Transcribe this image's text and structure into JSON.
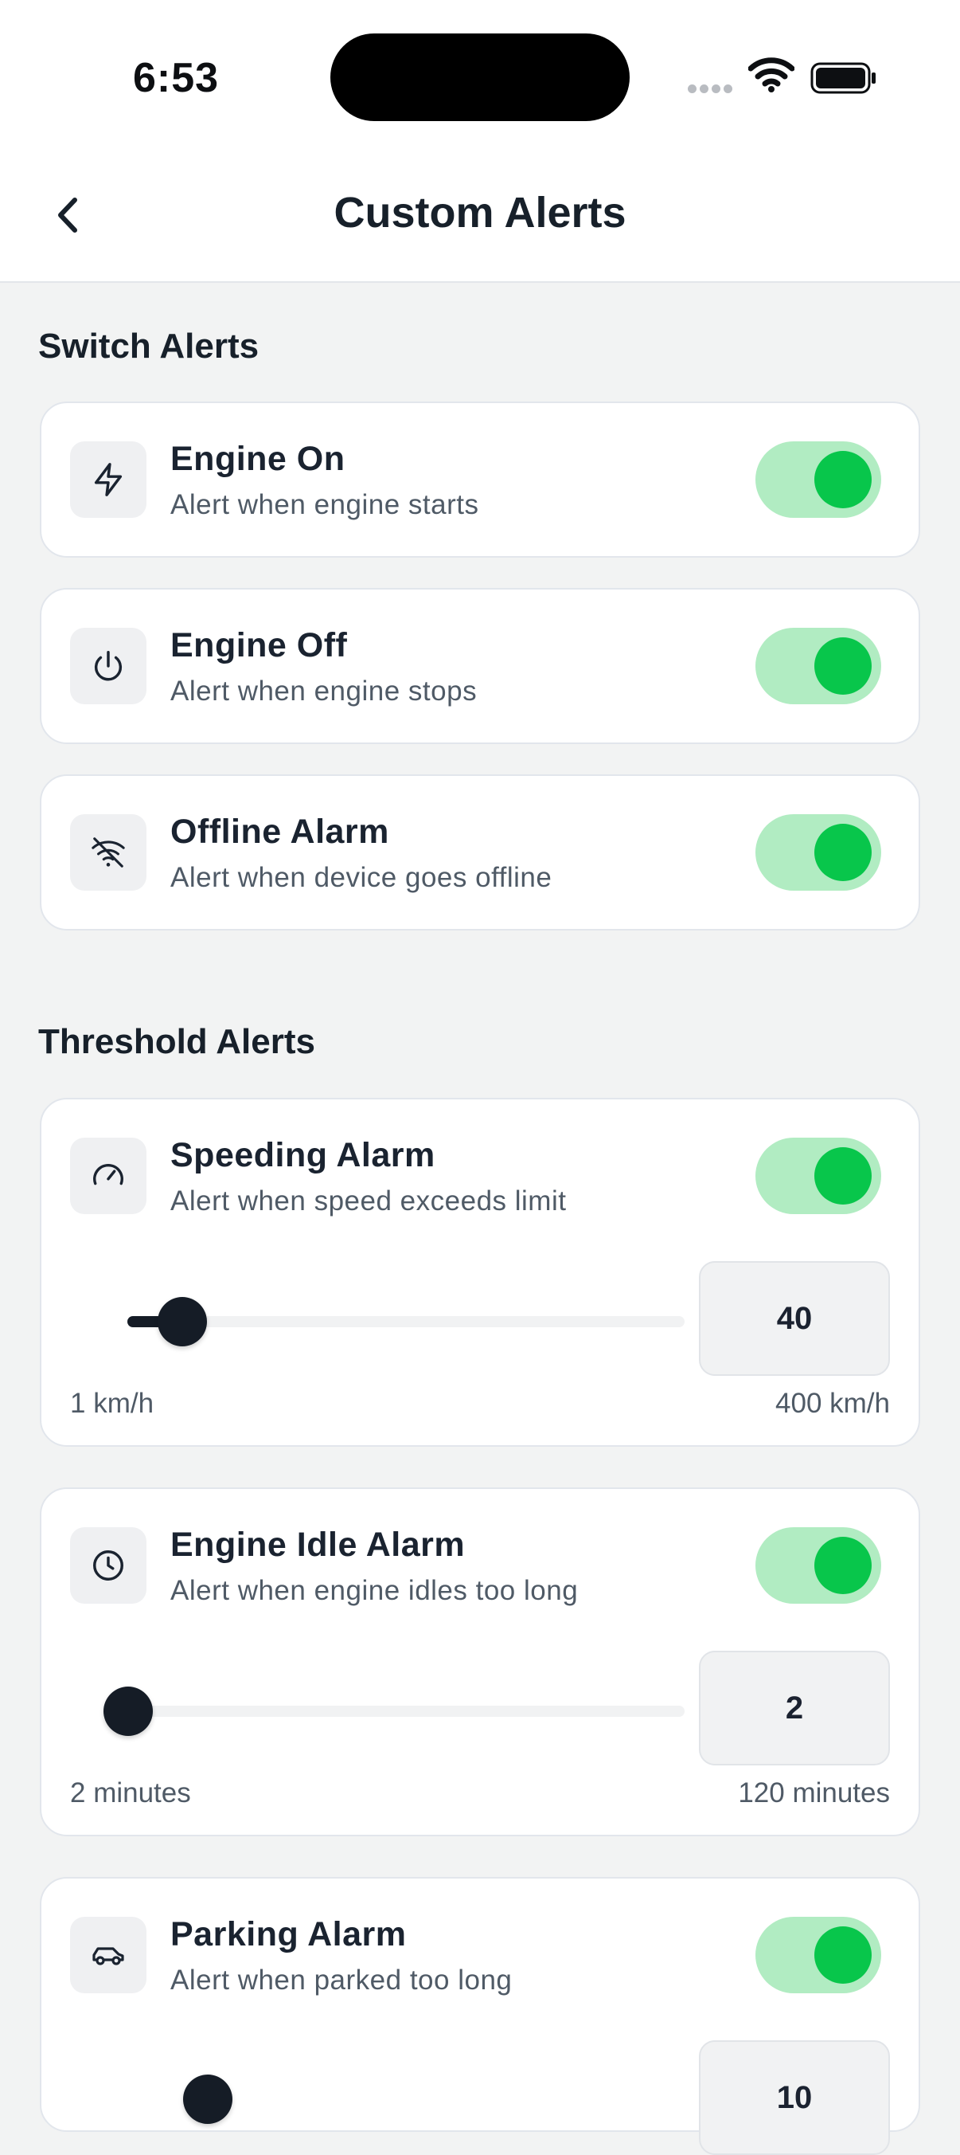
{
  "status_bar": {
    "time": "6:53"
  },
  "header": {
    "title": "Custom Alerts"
  },
  "switch_section": {
    "title": "Switch Alerts",
    "items": [
      {
        "name": "Engine On",
        "description": "Alert when engine starts",
        "icon": "lightning-icon",
        "enabled": true
      },
      {
        "name": "Engine Off",
        "description": "Alert when engine stops",
        "icon": "power-icon",
        "enabled": true
      },
      {
        "name": "Offline Alarm",
        "description": "Alert when device goes offline",
        "icon": "wifi-off-icon",
        "enabled": true
      }
    ]
  },
  "threshold_section": {
    "title": "Threshold Alerts",
    "items": [
      {
        "name": "Speeding Alarm",
        "description": "Alert when speed exceeds limit",
        "icon": "speedometer-icon",
        "enabled": true,
        "value": "40",
        "min_label": "1 km/h",
        "max_label": "400 km/h",
        "min": 1,
        "max": 400,
        "current": 40
      },
      {
        "name": "Engine Idle Alarm",
        "description": "Alert when engine idles too long",
        "icon": "clock-icon",
        "enabled": true,
        "value": "2",
        "min_label": "2 minutes",
        "max_label": "120 minutes",
        "min": 2,
        "max": 120,
        "current": 2
      },
      {
        "name": "Parking Alarm",
        "description": "Alert when parked too long",
        "icon": "car-icon",
        "enabled": true,
        "value": "10"
      }
    ]
  },
  "colors": {
    "toggle_on_track": "#b1ecc2",
    "toggle_on_knob": "#08c64b",
    "slider_thumb": "#151c26"
  }
}
